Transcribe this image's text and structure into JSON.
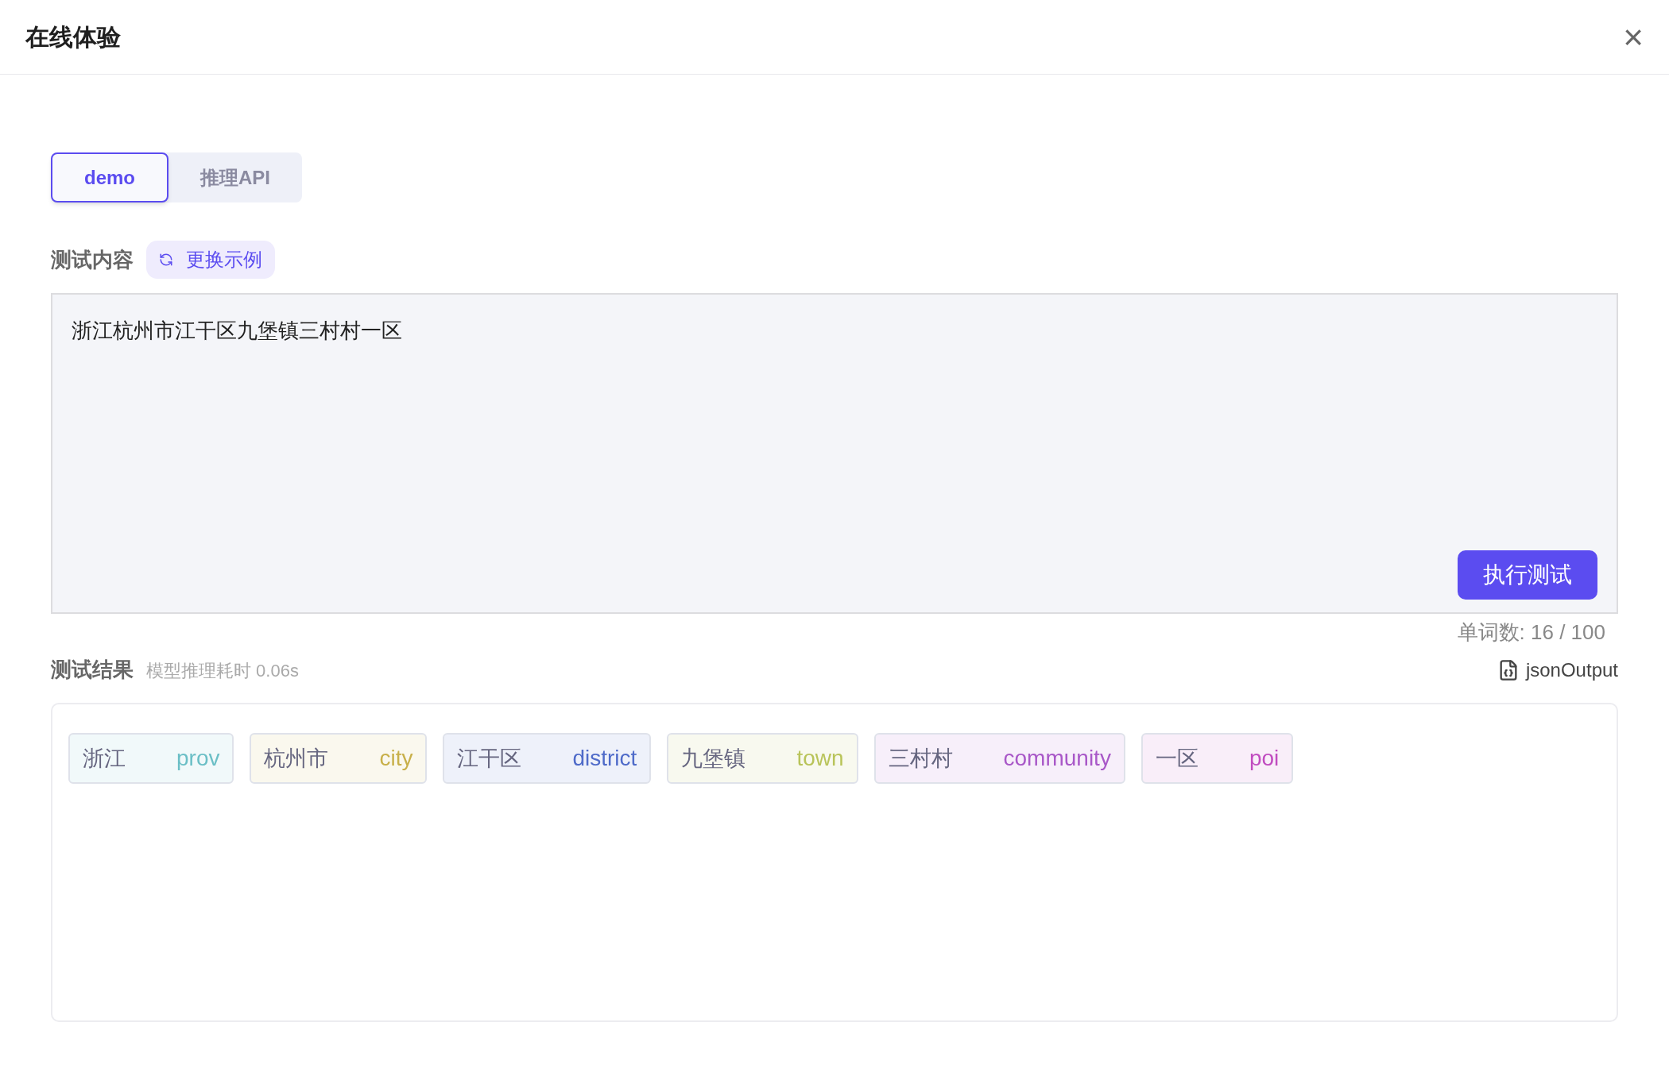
{
  "dialog": {
    "title": "在线体验",
    "close": "×"
  },
  "tabs": [
    {
      "label": "demo",
      "selected": true
    },
    {
      "label": "推理API",
      "selected": false
    }
  ],
  "input_section": {
    "label": "测试内容",
    "swap_button": "更换示例",
    "value": "浙江杭州市江干区九堡镇三村村一区",
    "run_button": "执行测试",
    "word_count": "单词数: 16 / 100"
  },
  "result_section": {
    "label": "测试结果",
    "timing": "模型推理耗时 0.06s",
    "json_output": "jsonOutput",
    "tags": [
      {
        "text": "浙江",
        "type": "prov",
        "color": "#6bbfc6"
      },
      {
        "text": "杭州市",
        "type": "city",
        "color": "#c8b04a"
      },
      {
        "text": "江干区",
        "type": "district",
        "color": "#4f6bc9"
      },
      {
        "text": "九堡镇",
        "type": "town",
        "color": "#b9c45a"
      },
      {
        "text": "三村村",
        "type": "community",
        "color": "#a958c8"
      },
      {
        "text": "一区",
        "type": "poi",
        "color": "#c14cc0"
      }
    ]
  }
}
